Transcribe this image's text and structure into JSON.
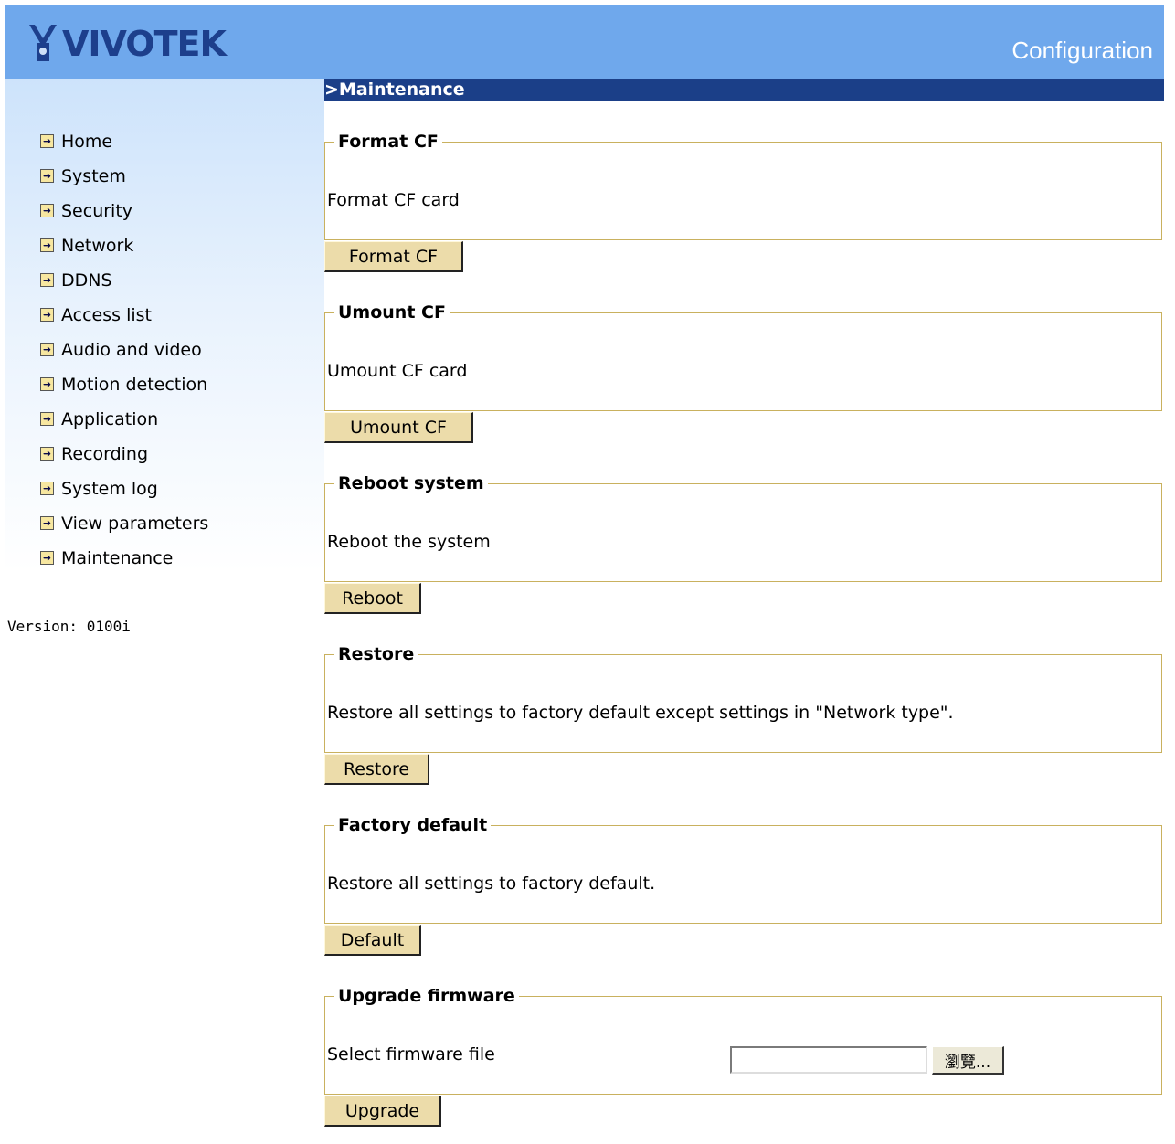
{
  "header": {
    "logo_text": "VIVOTEK",
    "title": "Configuration",
    "bg_color": "#6fa8ec"
  },
  "sidebar": {
    "items": [
      {
        "label": "Home",
        "icon": "arrow-right-icon"
      },
      {
        "label": "System",
        "icon": "arrow-right-icon"
      },
      {
        "label": "Security",
        "icon": "arrow-right-icon"
      },
      {
        "label": "Network",
        "icon": "arrow-right-icon"
      },
      {
        "label": "DDNS",
        "icon": "arrow-right-icon"
      },
      {
        "label": "Access list",
        "icon": "arrow-right-icon"
      },
      {
        "label": "Audio and video",
        "icon": "arrow-right-icon"
      },
      {
        "label": "Motion detection",
        "icon": "arrow-right-icon"
      },
      {
        "label": "Application",
        "icon": "arrow-right-icon"
      },
      {
        "label": "Recording",
        "icon": "arrow-right-icon"
      },
      {
        "label": "System log",
        "icon": "arrow-right-icon"
      },
      {
        "label": "View parameters",
        "icon": "arrow-right-icon"
      },
      {
        "label": "Maintenance",
        "icon": "arrow-right-icon"
      }
    ],
    "version": "Version: 0100i"
  },
  "main": {
    "section_title": ">Maintenance",
    "section_bar_color": "#1b3f88",
    "groups": [
      {
        "legend": "Format CF",
        "description": "Format CF card",
        "button": "Format CF"
      },
      {
        "legend": "Umount CF",
        "description": "Umount CF card",
        "button": "Umount CF"
      },
      {
        "legend": "Reboot system",
        "description": "Reboot the system",
        "button": "Reboot"
      },
      {
        "legend": "Restore",
        "description": "Restore all settings to factory default except settings in \"Network type\".",
        "button": "Restore"
      },
      {
        "legend": "Factory default",
        "description": "Restore all settings to factory default.",
        "button": "Default"
      },
      {
        "legend": "Upgrade firmware",
        "description": "Select firmware file",
        "button": "Upgrade",
        "file_value": "",
        "browse_label": "瀏覽..."
      }
    ]
  }
}
